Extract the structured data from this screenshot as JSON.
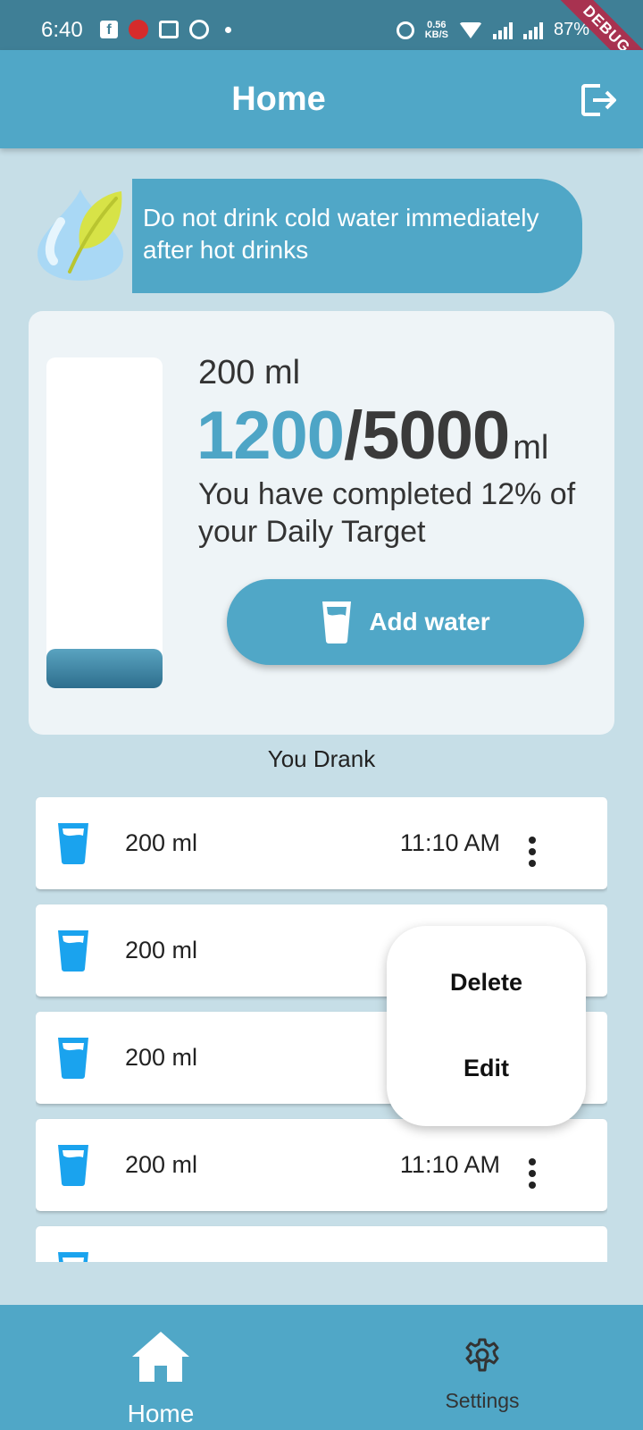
{
  "status_bar": {
    "time": "6:40",
    "speed_value": "0.56",
    "speed_unit": "KB/S",
    "battery": "87%",
    "debug_label": "DEBUG"
  },
  "app_bar": {
    "title": "Home"
  },
  "tip": {
    "text": "Do not drink cold water immediately after hot drinks"
  },
  "summary": {
    "cup_size": "200 ml",
    "current": "1200",
    "separator": "/",
    "target": "5000",
    "unit": "ml",
    "progress_text": "You have completed 12% of your Daily Target",
    "progress_fraction": 0.12,
    "add_button_label": "Add water"
  },
  "history": {
    "title": "You Drank",
    "entries": [
      {
        "amount": "200 ml",
        "time": "11:10 AM"
      },
      {
        "amount": "200 ml",
        "time": ""
      },
      {
        "amount": "200 ml",
        "time": ""
      },
      {
        "amount": "200 ml",
        "time": "11:10 AM"
      },
      {
        "amount": "",
        "time": ""
      }
    ]
  },
  "popup_menu": {
    "delete_label": "Delete",
    "edit_label": "Edit"
  },
  "bottom_nav": {
    "home_label": "Home",
    "settings_label": "Settings"
  },
  "colors": {
    "primary": "#50a7c7",
    "background": "#c6dee7",
    "status_bar": "#3f7f96",
    "glass_icon": "#1aa3ee",
    "accent_number": "#4ea5c6"
  }
}
